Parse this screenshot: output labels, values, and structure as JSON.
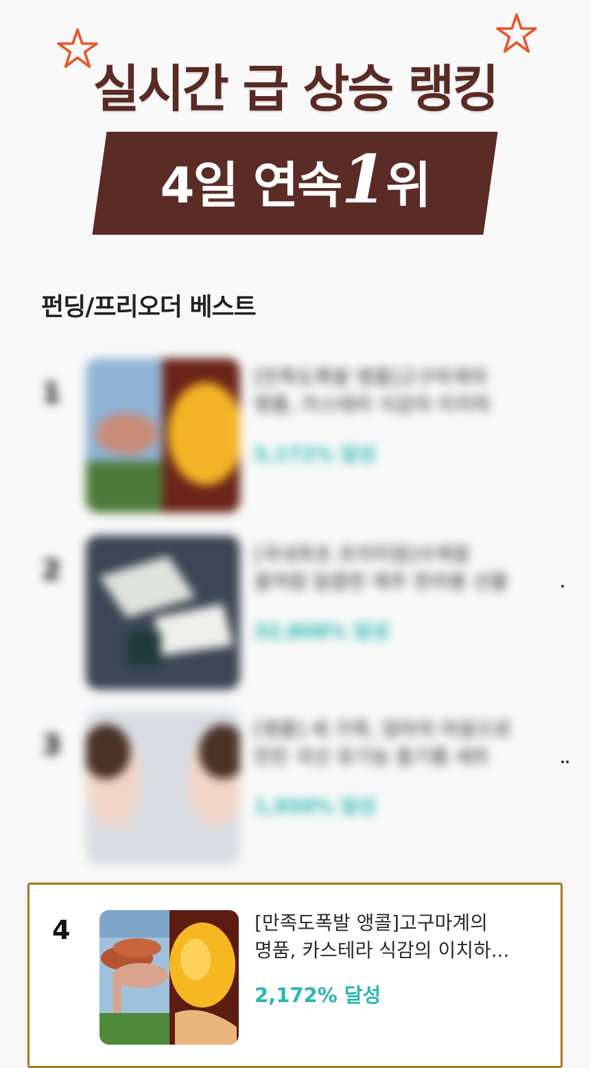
{
  "header": {
    "headline": "실시간 급 상승 랭킹",
    "banner_prefix": "4일 연속",
    "banner_number": "1",
    "banner_suffix": "위"
  },
  "section_title": "펀딩/프리오더 베스트",
  "items": [
    {
      "rank": "1",
      "title_line1": "[만족도폭발 앵콜]고구마계의",
      "title_line2": "명품, 카스테라 식감의 이치하",
      "achievement": "5,172% 달성",
      "blurred": true
    },
    {
      "rank": "2",
      "title_line1": "[국내최초 프리미엄]사계절",
      "title_line2": "꿀처럼 달콤한 제주 한라봉 선물",
      "achievement": "32,808% 달성",
      "blurred": true
    },
    {
      "rank": "3",
      "title_line1": "[앵콜] 세 가족, 엄마의 마음으로",
      "title_line2": "만든 국산 유기농 들기름 세트",
      "achievement": "1,950% 달성",
      "blurred": true
    },
    {
      "rank": "4",
      "title_line1": "[만족도폭발 앵콜]고구마계의",
      "title_line2": "명품, 카스테라 식감의 이치하...",
      "achievement": "2,172% 달성",
      "blurred": false
    }
  ],
  "colors": {
    "brand_brown": "#5b2c26",
    "accent_orange": "#e8562b",
    "achievement_teal": "#2bb8b0",
    "highlight_border": "#a37a27"
  },
  "icons": [
    "star-icon"
  ]
}
